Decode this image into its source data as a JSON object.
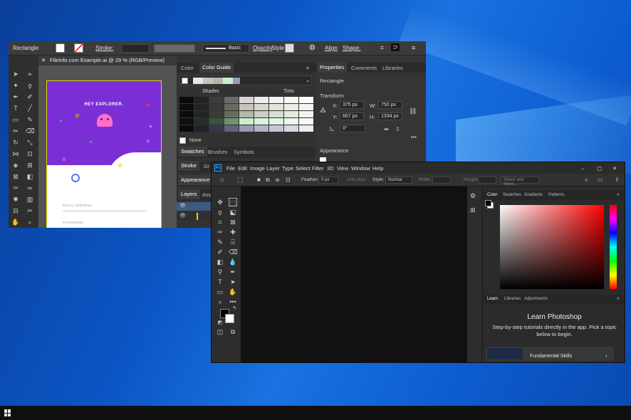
{
  "illustrator": {
    "control_bar": {
      "tool": "Rectangle",
      "stroke_label": "Stroke:",
      "brush": "Basic",
      "opacity_label": "Opacity",
      "style_label": "Style:",
      "align_label": "Align",
      "shape_label": "Shape:"
    },
    "doc_tab": "FileInfo.com Example.ai @ 29 % (RGB/Preview)",
    "artboard": {
      "heading": "HEY EXPLORER.",
      "email_label": "EMAIL ADDRESS",
      "password_label": "PASSWORD",
      "purple": "#7a2fd6",
      "mascot_color": "#ff6ec7"
    },
    "color_panel": {
      "tabs": [
        "Color",
        "Color Guide"
      ],
      "shades_label": "Shades",
      "tints_label": "Tints",
      "none_label": "None"
    },
    "swatch_tabs": [
      "Swatches",
      "Brushes",
      "Symbols"
    ],
    "stroke_tabs": [
      "Stroke",
      "Gr"
    ],
    "appearance_tab": "Appearance",
    "layers_tabs": [
      "Layers",
      "Ass"
    ],
    "properties": {
      "tabs": [
        "Properties",
        "Comments",
        "Libraries"
      ],
      "object": "Rectangle",
      "transform_label": "Transform",
      "x_label": "X:",
      "x": "375 px",
      "w_label": "W:",
      "w": "750 px",
      "y_label": "Y:",
      "y": "667 px",
      "h_label": "H:",
      "h": "1334 px",
      "angle": "0°",
      "appearance_label": "Appearance"
    }
  },
  "photoshop": {
    "logo": "Ps",
    "menu": [
      "File",
      "Edit",
      "Image",
      "Layer",
      "Type",
      "Select",
      "Filter",
      "3D",
      "View",
      "Window",
      "Help"
    ],
    "options": {
      "feather_label": "Feather:",
      "feather": "0 px",
      "antialias": "Anti-alias",
      "style_label": "Style:",
      "style": "Normal",
      "width_label": "Width:",
      "height_label": "Height:",
      "select_mask": "Select and Mask..."
    },
    "color_tabs": [
      "Color",
      "Swatches",
      "Gradients",
      "Patterns"
    ],
    "learn_tabs": [
      "Learn",
      "Libraries",
      "Adjustments"
    ],
    "learn": {
      "title": "Learn Photoshop",
      "subtitle": "Step-by-step tutorials directly in the app. Pick a topic below to begin.",
      "card": "Fundamental Skills"
    }
  }
}
